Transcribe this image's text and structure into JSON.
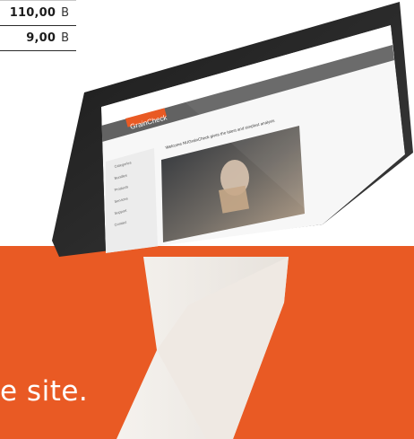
{
  "price_table": {
    "rows": [
      {
        "amount": "110,00",
        "unit": "B"
      },
      {
        "amount": "9,00",
        "unit": "B"
      }
    ]
  },
  "banner": {
    "tagline": "e site.",
    "background_color": "#e95a24"
  },
  "device": {
    "icon": "monitor-stand-icon",
    "website_logo_text": "GrainCheck",
    "hero_heading": "Welcome NUGrainCheck gives the latest and simplest analysis",
    "sidebar_items": [
      "Categories",
      "Bundles",
      "Products",
      "Services",
      "Support",
      "Contact"
    ]
  }
}
